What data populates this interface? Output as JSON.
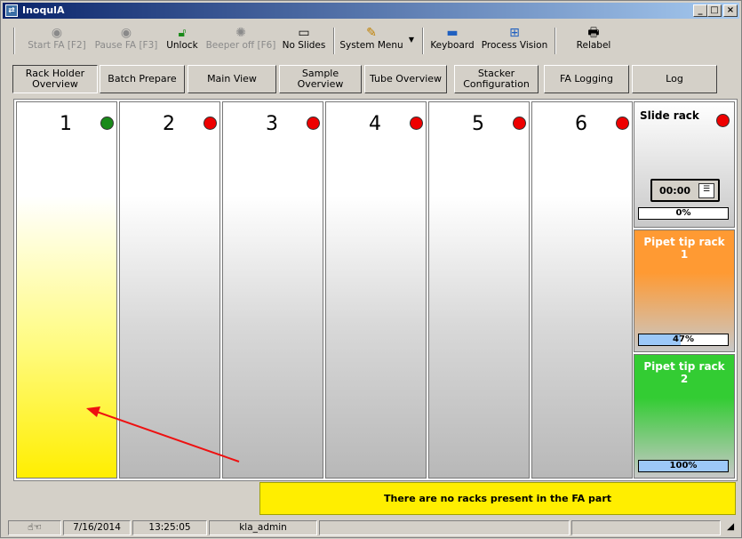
{
  "window": {
    "title": "InoqulA",
    "minimize": "_",
    "maximize": "□",
    "close": "×"
  },
  "toolbar": {
    "start_fa": "Start FA [F2]",
    "pause_fa": "Pause FA [F3]",
    "unlock": "Unlock",
    "beeper_off": "Beeper off [F6]",
    "no_slides": "No Slides",
    "system_menu": "System Menu",
    "keyboard": "Keyboard",
    "process_vision": "Process Vision",
    "relabel": "Relabel"
  },
  "tabs": [
    {
      "label": "Rack Holder Overview",
      "active": true
    },
    {
      "label": "Batch Prepare",
      "active": false
    },
    {
      "label": "Main View",
      "active": false
    },
    {
      "label": "Sample Overview",
      "active": false
    },
    {
      "label": "Tube Overview",
      "active": false
    },
    {
      "label": "Stacker Configuration",
      "active": false
    },
    {
      "label": "FA Logging",
      "active": false
    },
    {
      "label": "Log",
      "active": false
    }
  ],
  "racks": [
    {
      "number": "1",
      "status_color": "#1a8a1a",
      "fill": "yellow"
    },
    {
      "number": "2",
      "status_color": "#ee0000",
      "fill": "gray"
    },
    {
      "number": "3",
      "status_color": "#ee0000",
      "fill": "gray"
    },
    {
      "number": "4",
      "status_color": "#ee0000",
      "fill": "gray"
    },
    {
      "number": "5",
      "status_color": "#ee0000",
      "fill": "gray"
    },
    {
      "number": "6",
      "status_color": "#ee0000",
      "fill": "gray"
    }
  ],
  "slide_rack": {
    "title": "Slide rack",
    "time": "00:00",
    "percent_label": "0%",
    "percent": 0,
    "status_color": "#ee0000"
  },
  "pipet_rack_1": {
    "title": "Pipet tip rack",
    "number": "1",
    "percent_label": "47%",
    "percent": 47,
    "color": "#ff9a33"
  },
  "pipet_rack_2": {
    "title": "Pipet tip rack",
    "number": "2",
    "percent_label": "100%",
    "percent": 100,
    "color": "#33cc33"
  },
  "message": "There are no racks present in the FA part",
  "status_bar": {
    "date": "7/16/2014",
    "time": "13:25:05",
    "user": "kla_admin"
  }
}
